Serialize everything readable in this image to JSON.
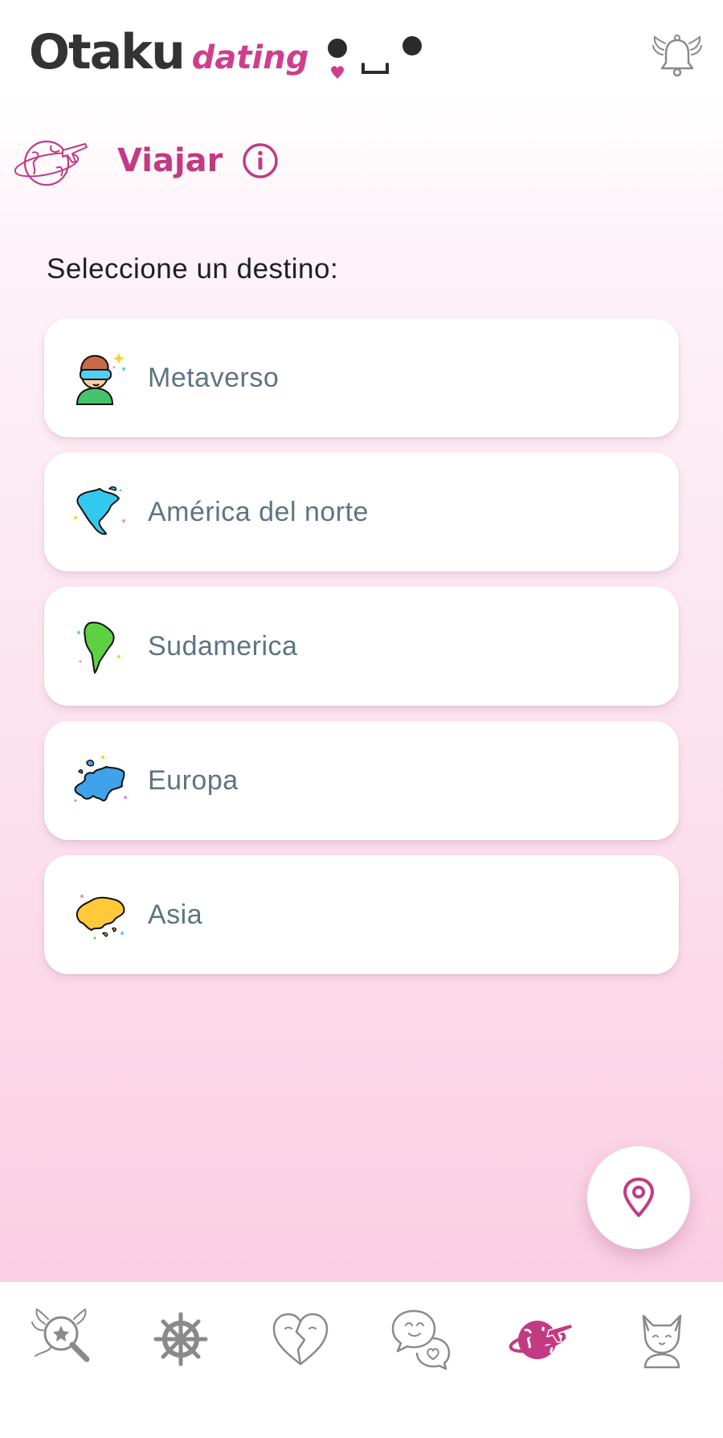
{
  "header": {
    "logo_main": "Otaku",
    "logo_sub": "dating",
    "notification_icon": "bell-with-wings-icon"
  },
  "section": {
    "title": "Viajar",
    "icon": "globe-plane-icon",
    "info_icon": "info-icon"
  },
  "prompt": "Seleccione un destino:",
  "destinations": [
    {
      "label": "Metaverso",
      "icon": "vr-headset-person-icon"
    },
    {
      "label": "América del norte",
      "icon": "north-america-map-icon"
    },
    {
      "label": "Sudamerica",
      "icon": "south-america-map-icon"
    },
    {
      "label": "Europa",
      "icon": "europe-map-icon"
    },
    {
      "label": "Asia",
      "icon": "asia-map-icon"
    }
  ],
  "fab": {
    "icon": "location-pin-icon"
  },
  "bottom_nav": {
    "items": [
      {
        "icon": "magic-search-icon",
        "active": false
      },
      {
        "icon": "ship-wheel-icon",
        "active": false
      },
      {
        "icon": "broken-heart-icon",
        "active": false
      },
      {
        "icon": "chat-bubbles-icon",
        "active": false
      },
      {
        "icon": "globe-plane-icon",
        "active": true
      },
      {
        "icon": "cat-profile-icon",
        "active": false
      }
    ]
  },
  "colors": {
    "accent": "#c23a84",
    "logo_text": "#333333",
    "destination_text": "#5d7482",
    "icon_inactive": "#8a8a8a"
  }
}
